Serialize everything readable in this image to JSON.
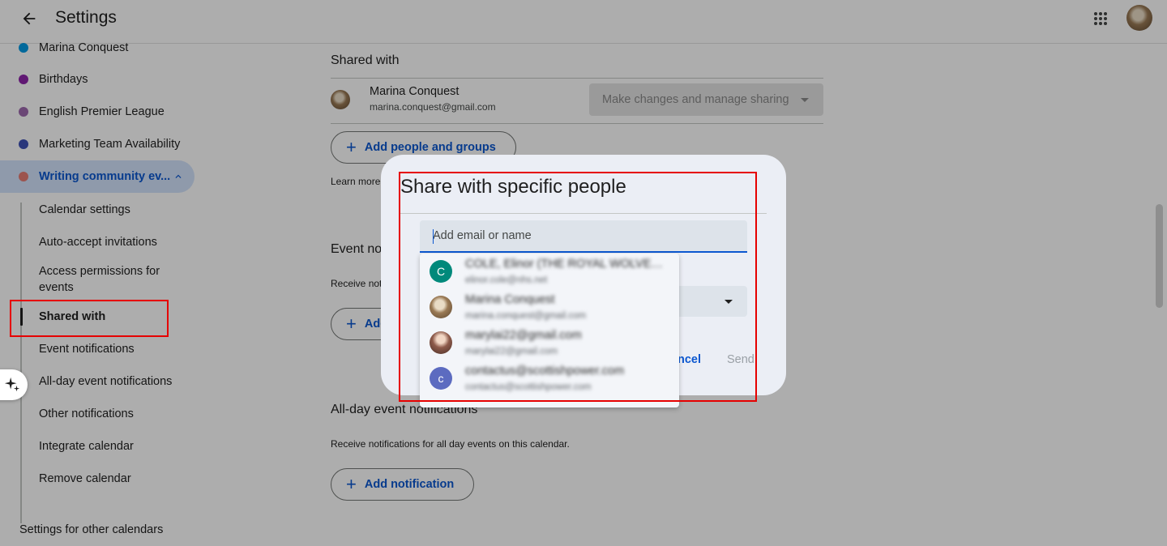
{
  "header": {
    "title": "Settings"
  },
  "sidebar": {
    "calendars": [
      {
        "label": "Marina Conquest",
        "color": "#039be5"
      },
      {
        "label": "Birthdays",
        "color": "#8e24aa"
      },
      {
        "label": "English Premier League",
        "color": "#9e69af"
      },
      {
        "label": "Marketing Team Availability",
        "color": "#3f51b5"
      },
      {
        "label": "Writing community ev...",
        "color": "#e67c73"
      }
    ],
    "sub_items": [
      "Calendar settings",
      "Auto-accept invitations",
      "Access permissions for events",
      "Shared with",
      "Event notifications",
      "All-day event notifications",
      "Other notifications",
      "Integrate calendar",
      "Remove calendar"
    ],
    "other_calendars": "Settings for other calendars"
  },
  "main": {
    "shared_with_title": "Shared with",
    "owner_name": "Marina Conquest",
    "owner_email": "marina.conquest@gmail.com",
    "permission_value": "Make changes and manage sharing",
    "add_people_label": "Add people and groups",
    "learn_more": "Learn more",
    "event_notifications_title": "Event no",
    "event_notifications_helper": "Receive not",
    "add_event_notification_label": "Add",
    "allday_title": "All-day event notifications",
    "allday_helper": "Receive notifications for all day events on this calendar.",
    "add_notification_label": "Add notification"
  },
  "dialog": {
    "title": "Share with specific people",
    "email_placeholder": "Add email or name",
    "cancel_label": "ncel",
    "send_label": "Send",
    "suggestions": [
      {
        "initial": "C",
        "name": "COLE, Elinor (THE ROYAL WOLVERHA...",
        "email": "elinor.cole@nhs.net",
        "color": "#00897b"
      },
      {
        "initial": "",
        "name": "Marina Conquest",
        "email": "marina.conquest@gmail.com",
        "color": "#9a7a55"
      },
      {
        "initial": "",
        "name": "marylai22@gmail.com",
        "email": "marylai22@gmail.com",
        "color": "#6d4c41"
      },
      {
        "initial": "c",
        "name": "contactus@scottishpower.com",
        "email": "contactus@scottishpower.com",
        "color": "#5c6bc0"
      }
    ]
  }
}
